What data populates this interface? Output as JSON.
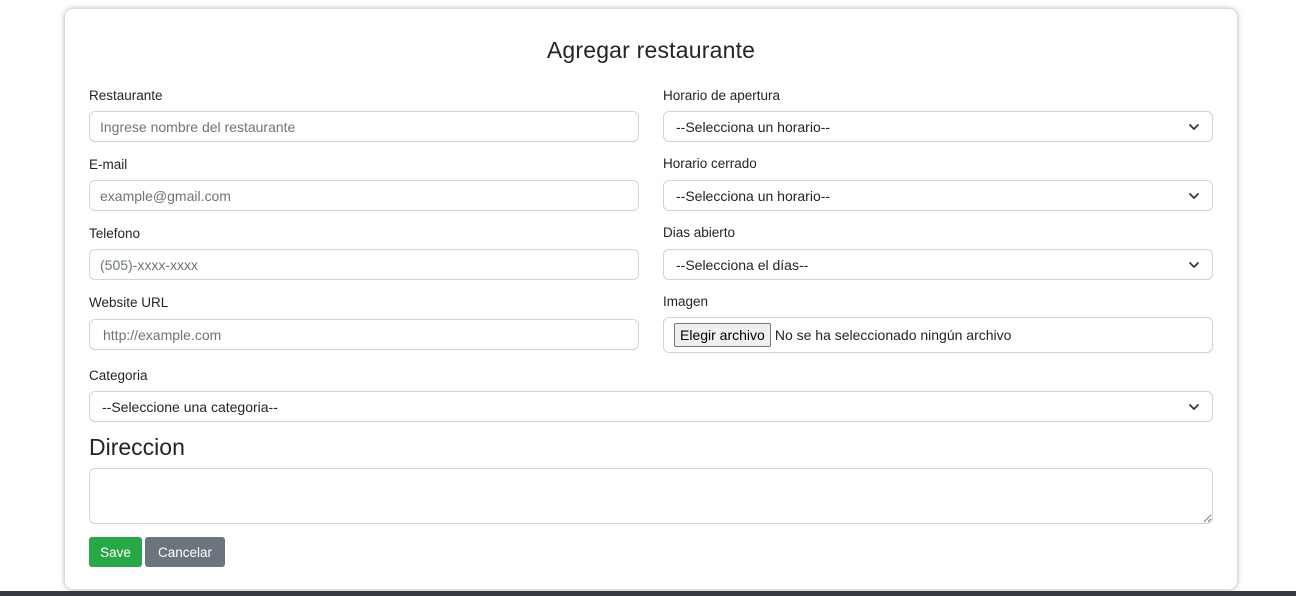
{
  "form": {
    "title": "Agregar restaurante",
    "restaurante": {
      "label": "Restaurante",
      "placeholder": "Ingrese nombre del restaurante"
    },
    "email": {
      "label": "E-mail",
      "placeholder": "example@gmail.com"
    },
    "telefono": {
      "label": "Telefono",
      "placeholder": "(505)-xxxx-xxxx"
    },
    "website": {
      "label": "Website URL",
      "placeholder": "http://example.com"
    },
    "horario_apertura": {
      "label": "Horario de apertura",
      "selected": "--Selecciona un horario--"
    },
    "horario_cerrado": {
      "label": "Horario cerrado",
      "selected": "--Selecciona un horario--"
    },
    "dias_abierto": {
      "label": "Dias abierto",
      "selected": "--Selecciona el días--"
    },
    "imagen": {
      "label": "Imagen",
      "button_label": "Elegir archivo",
      "status": "No se ha seleccionado ningún archivo"
    },
    "categoria": {
      "label": "Categoria",
      "selected": "--Seleccione una categoria--"
    },
    "direccion": {
      "label": "Direccion",
      "value": ""
    },
    "buttons": {
      "save": "Save",
      "cancel": "Cancelar"
    }
  },
  "colors": {
    "save": "#28a745",
    "cancel": "#6c757d",
    "border": "#ced4da",
    "footer_bar": "#343a40"
  },
  "icons": {
    "select_arrow": "chevron-down-icon"
  }
}
